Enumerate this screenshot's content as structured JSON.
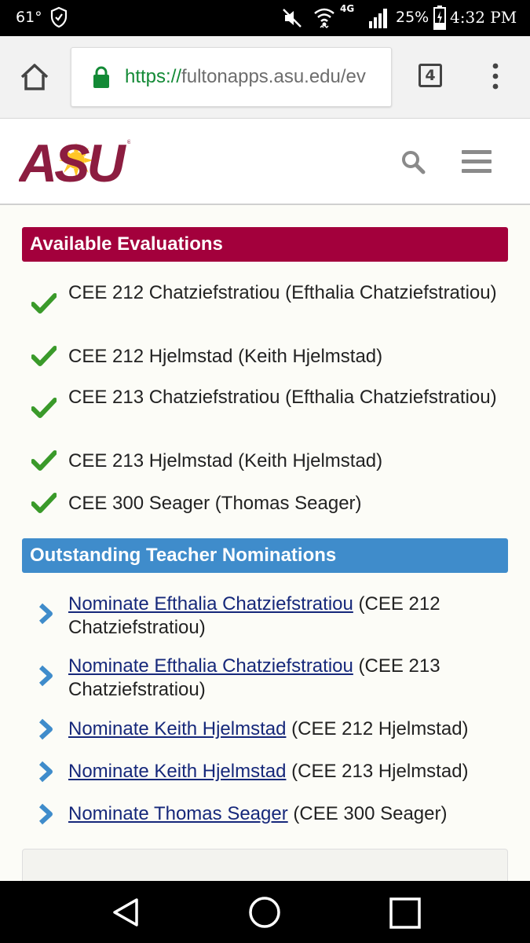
{
  "status_bar": {
    "temperature": "61°",
    "network": "4G",
    "battery": "25%",
    "time": "4:32 PM",
    "icons": [
      "shield-icon",
      "mute-icon",
      "wifi-icon",
      "signal-icon",
      "battery-charging-icon"
    ]
  },
  "browser": {
    "url_scheme": "https://",
    "url_rest": "fultonapps.asu.edu/ev",
    "tab_count": "4",
    "secure": true,
    "accent_color": "#138a36"
  },
  "site": {
    "logo_text": "ASU",
    "brand_maroon": "#8c1d40",
    "brand_gold": "#ffc627"
  },
  "evaluations": {
    "heading": "Available Evaluations",
    "heading_color": "#a3003c",
    "items": [
      "CEE 212 Chatziefstratiou (Efthalia Chatziefstratiou)",
      "CEE 212 Hjelmstad (Keith Hjelmstad)",
      "CEE 213 Chatziefstratiou (Efthalia Chatziefstratiou)",
      "CEE 213 Hjelmstad (Keith Hjelmstad)",
      "CEE 300 Seager (Thomas Seager)"
    ]
  },
  "nominations": {
    "heading": "Outstanding Teacher Nominations",
    "heading_color": "#3f8ccb",
    "items": [
      {
        "link": "Nominate Efthalia Chatziefstratiou",
        "course": "(CEE 212 Chatziefstratiou)"
      },
      {
        "link": "Nominate Efthalia Chatziefstratiou",
        "course": "(CEE 213 Chatziefstratiou)"
      },
      {
        "link": "Nominate Keith Hjelmstad",
        "course": "(CEE 212 Hjelmstad)"
      },
      {
        "link": "Nominate Keith Hjelmstad",
        "course": "(CEE 213 Hjelmstad)"
      },
      {
        "link": "Nominate Thomas Seager",
        "course": "(CEE 300 Seager)"
      }
    ]
  }
}
